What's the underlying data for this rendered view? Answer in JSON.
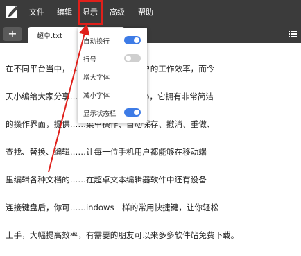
{
  "menubar": {
    "logo_icon": "notepad-logo-icon",
    "items": [
      "文件",
      "编辑",
      "显示",
      "高级",
      "帮助"
    ],
    "highlight_color": "#e0201b"
  },
  "tabbar": {
    "add_label": "+",
    "tab_title": "超卓.txt",
    "menu_icon": "list-icon"
  },
  "content": {
    "lines": [
      "在不同平台当中，……绝对能够提高用户的工作效率，而今",
      "天小编给大家分享……编辑器最新版app，它拥有非常简洁",
      "的操作界面，提供……菜单操作、自动保存、撤消、重做、",
      "查找、替换、编辑……让每一位手机用户都能够在移动端",
      "里编辑各种文档的……在超卓文本编辑器软件中还有设备",
      "连接键盘后，你可……indows一样的常用快捷键，让你轻松",
      "上手，大幅提高效率，有需要的朋友可以来多多软件站免费下载。"
    ]
  },
  "dropdown": {
    "items": [
      {
        "label": "自动换行",
        "toggle": true
      },
      {
        "label": "行号",
        "toggle": false
      },
      {
        "label": "增大字体"
      },
      {
        "label": "减小字体"
      },
      {
        "label": "显示状态栏",
        "toggle": true
      }
    ],
    "toggle_on_color": "#3d7be6",
    "toggle_off_color": "#cfcfcf"
  },
  "annotation": {
    "arrow_color": "#e0201b"
  }
}
